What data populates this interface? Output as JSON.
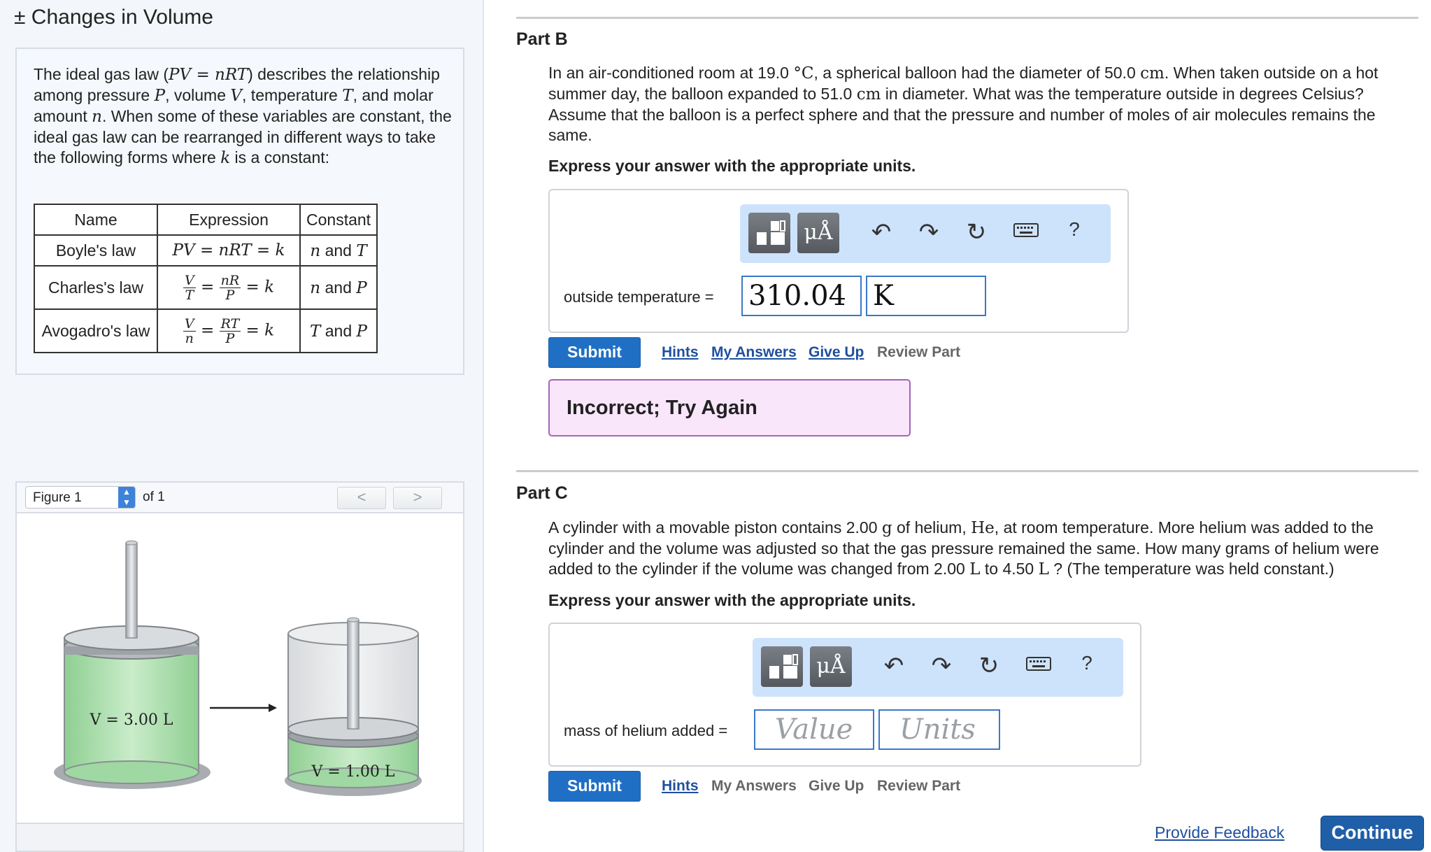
{
  "header": {
    "title": "± Changes in Volume"
  },
  "intro": {
    "p1": "The ideal gas law (",
    "eq": "PV = nRT",
    "p2": ") describes the relationship among pressure ",
    "P": "P",
    "p3": ", volume ",
    "V": "V",
    "p4": ", temperature ",
    "T": "T",
    "p5": ", and molar amount ",
    "n": "n",
    "p6": ". When some of these variables are constant, the ideal gas law can be rearranged in different ways to take the following forms where ",
    "k": "k",
    "p7": " is a constant:"
  },
  "laws_table": {
    "headers": [
      "Name",
      "Expression",
      "Constant"
    ],
    "rows": [
      {
        "name": "Boyle's law",
        "expr": "PV = nRT = k",
        "c1": "n",
        "and": " and ",
        "c2": "T"
      },
      {
        "name": "Charles's law",
        "num1": "V",
        "den1": "T",
        "num2": "nR",
        "den2": "P",
        "tail": "= k",
        "c1": "n",
        "and": " and ",
        "c2": "P"
      },
      {
        "name": "Avogadro's law",
        "num1": "V",
        "den1": "n",
        "num2": "RT",
        "den2": "P",
        "tail": "= k",
        "c1": "T",
        "and": " and ",
        "c2": "P"
      }
    ]
  },
  "figure": {
    "select_value": "Figure 1",
    "of_label": "of 1",
    "prev_label": "<",
    "next_label": ">",
    "left_label": "V = 3.00 L",
    "right_label": "V = 1.00 L"
  },
  "partB": {
    "title": "Part B",
    "question": {
      "a": "In an air-conditioned room at 19.0 ",
      "deg": "°C",
      "b": ", a spherical balloon had the diameter of 50.0 ",
      "u1": "cm",
      "c": ". When taken outside on a hot summer day, the balloon expanded to 51.0 ",
      "u2": "cm",
      "d": " in diameter. What was the temperature outside in degrees Celsius? Assume that the balloon is a perfect sphere and that the pressure and number of moles of air molecules remains the same."
    },
    "express": "Express your answer with the appropriate units.",
    "answer_label": "outside temperature =",
    "value": "310.04",
    "units": "K",
    "submit": "Submit",
    "links": [
      "Hints",
      "My Answers",
      "Give Up",
      "Review Part"
    ],
    "feedback": "Incorrect; Try Again"
  },
  "partC": {
    "title": "Part C",
    "question": {
      "a": "A cylinder with a movable piston contains 2.00 ",
      "g": "g",
      "b": " of helium, ",
      "he": "He",
      "c": ", at room temperature. More helium was added to the cylinder and the volume was adjusted so that the gas pressure remained the same. How many grams of helium were added to the cylinder if the volume was changed from 2.00 ",
      "L1": "L",
      "d": " to 4.50 ",
      "L2": "L",
      "e": " ? (The temperature was held constant.)"
    },
    "express": "Express your answer with the appropriate units.",
    "answer_label": "mass of helium added =",
    "value_placeholder": "Value",
    "units_placeholder": "Units",
    "submit": "Submit",
    "links": [
      "Hints",
      "My Answers",
      "Give Up",
      "Review Part"
    ]
  },
  "toolbar": {
    "mu_label": "μÅ",
    "help_label": "?"
  },
  "footer": {
    "feedback_link": "Provide Feedback",
    "continue_label": "Continue"
  }
}
